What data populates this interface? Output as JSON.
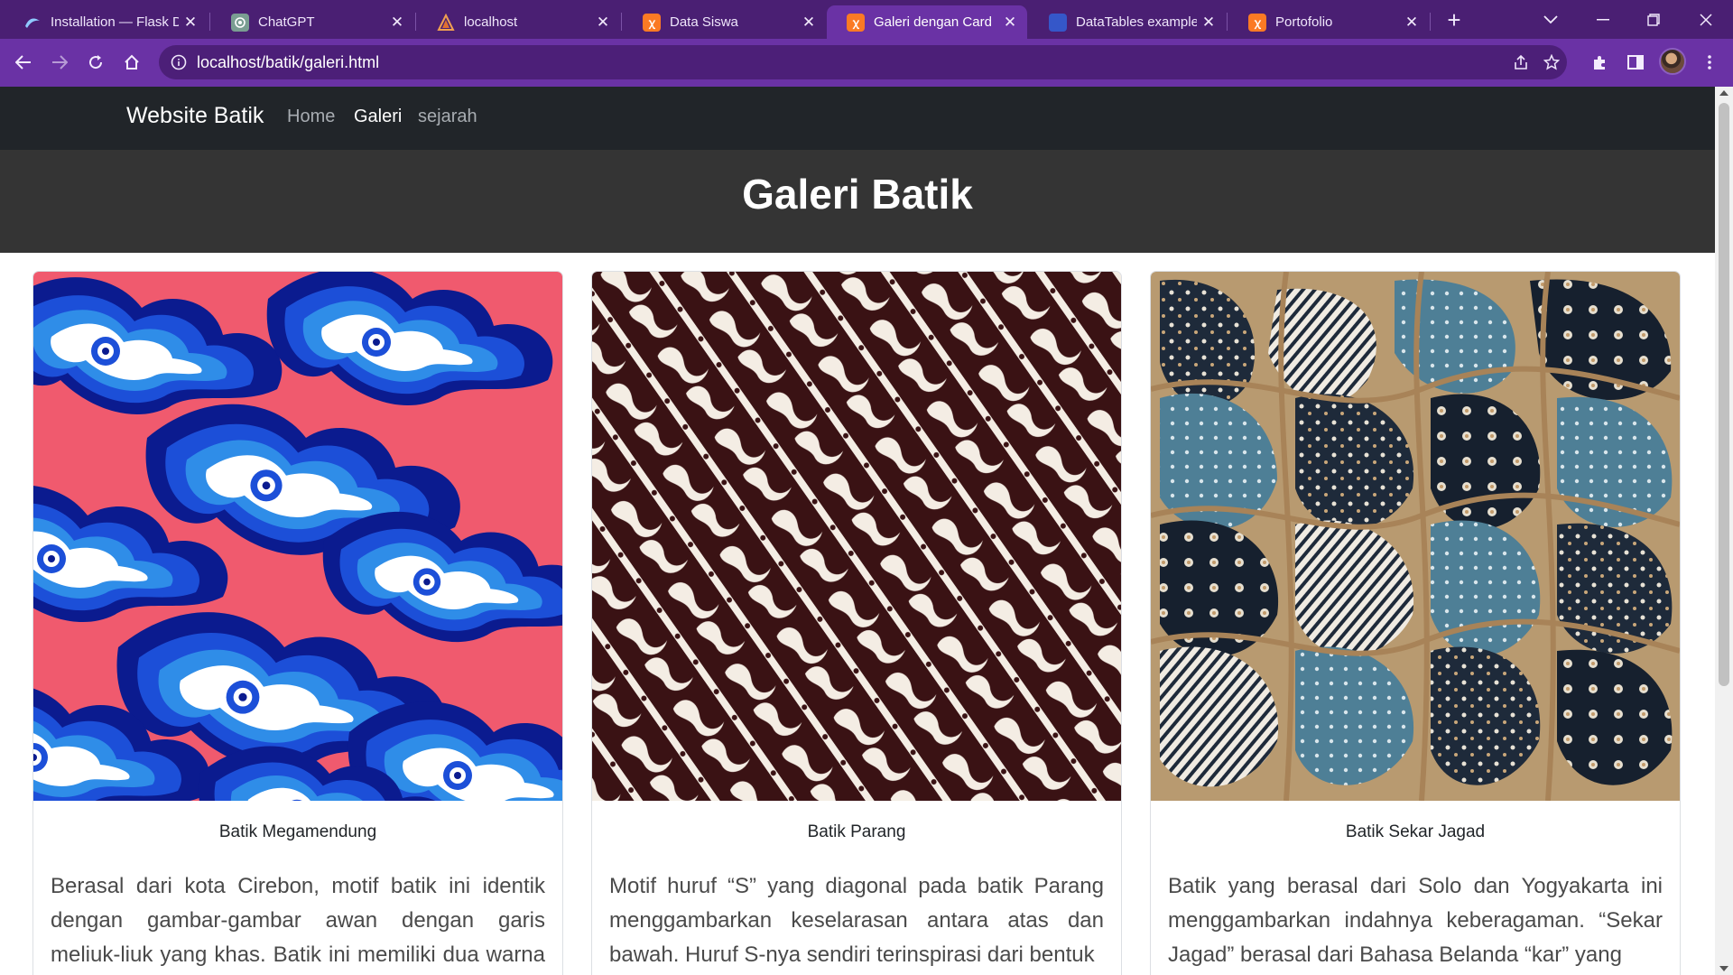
{
  "browser": {
    "tabs": [
      {
        "title": "Installation — Flask D",
        "icon": "flask-icon",
        "active": false
      },
      {
        "title": "ChatGPT",
        "icon": "chatgpt-icon",
        "active": false
      },
      {
        "title": "localhost",
        "icon": "localhost-icon",
        "active": false
      },
      {
        "title": "Data Siswa",
        "icon": "xampp-icon",
        "active": false
      },
      {
        "title": "Galeri dengan Card",
        "icon": "xampp-icon",
        "active": true
      },
      {
        "title": "DataTables example",
        "icon": "datatables-icon",
        "active": false
      },
      {
        "title": "Portofolio",
        "icon": "xampp-icon",
        "active": false
      }
    ],
    "new_tab_symbol": "+",
    "url": "localhost/batik/galeri.html",
    "colors": {
      "tabstrip": "#4a1f73",
      "toolbar": "#6a32a5",
      "omnibox": "#4c1f78"
    }
  },
  "page": {
    "navbar": {
      "brand": "Website Batik",
      "links": [
        {
          "label": "Home",
          "active": false
        },
        {
          "label": "Galeri",
          "active": true
        },
        {
          "label": "sejarah",
          "active": false
        }
      ]
    },
    "hero_title": "Galeri Batik",
    "cards": [
      {
        "image": "megamendung-pattern",
        "title": "Batik Megamendung",
        "text": "Berasal dari kota Cirebon, motif batik ini identik dengan gambar-gambar awan dengan garis meliuk-liuk yang khas. Batik ini memiliki dua warna dasar,"
      },
      {
        "image": "parang-pattern",
        "title": "Batik Parang",
        "text": "Motif huruf “S” yang diagonal pada batik Parang menggambarkan keselarasan antara atas dan bawah. Huruf S-nya sendiri terinspirasi dari bentuk"
      },
      {
        "image": "sekar-jagad-pattern",
        "title": "Batik Sekar Jagad",
        "text": "Batik yang berasal dari Solo dan Yogyakarta ini menggambarkan indahnya keberagaman. “Sekar Jagad” berasal dari Bahasa Belanda “kar” yang"
      }
    ]
  }
}
